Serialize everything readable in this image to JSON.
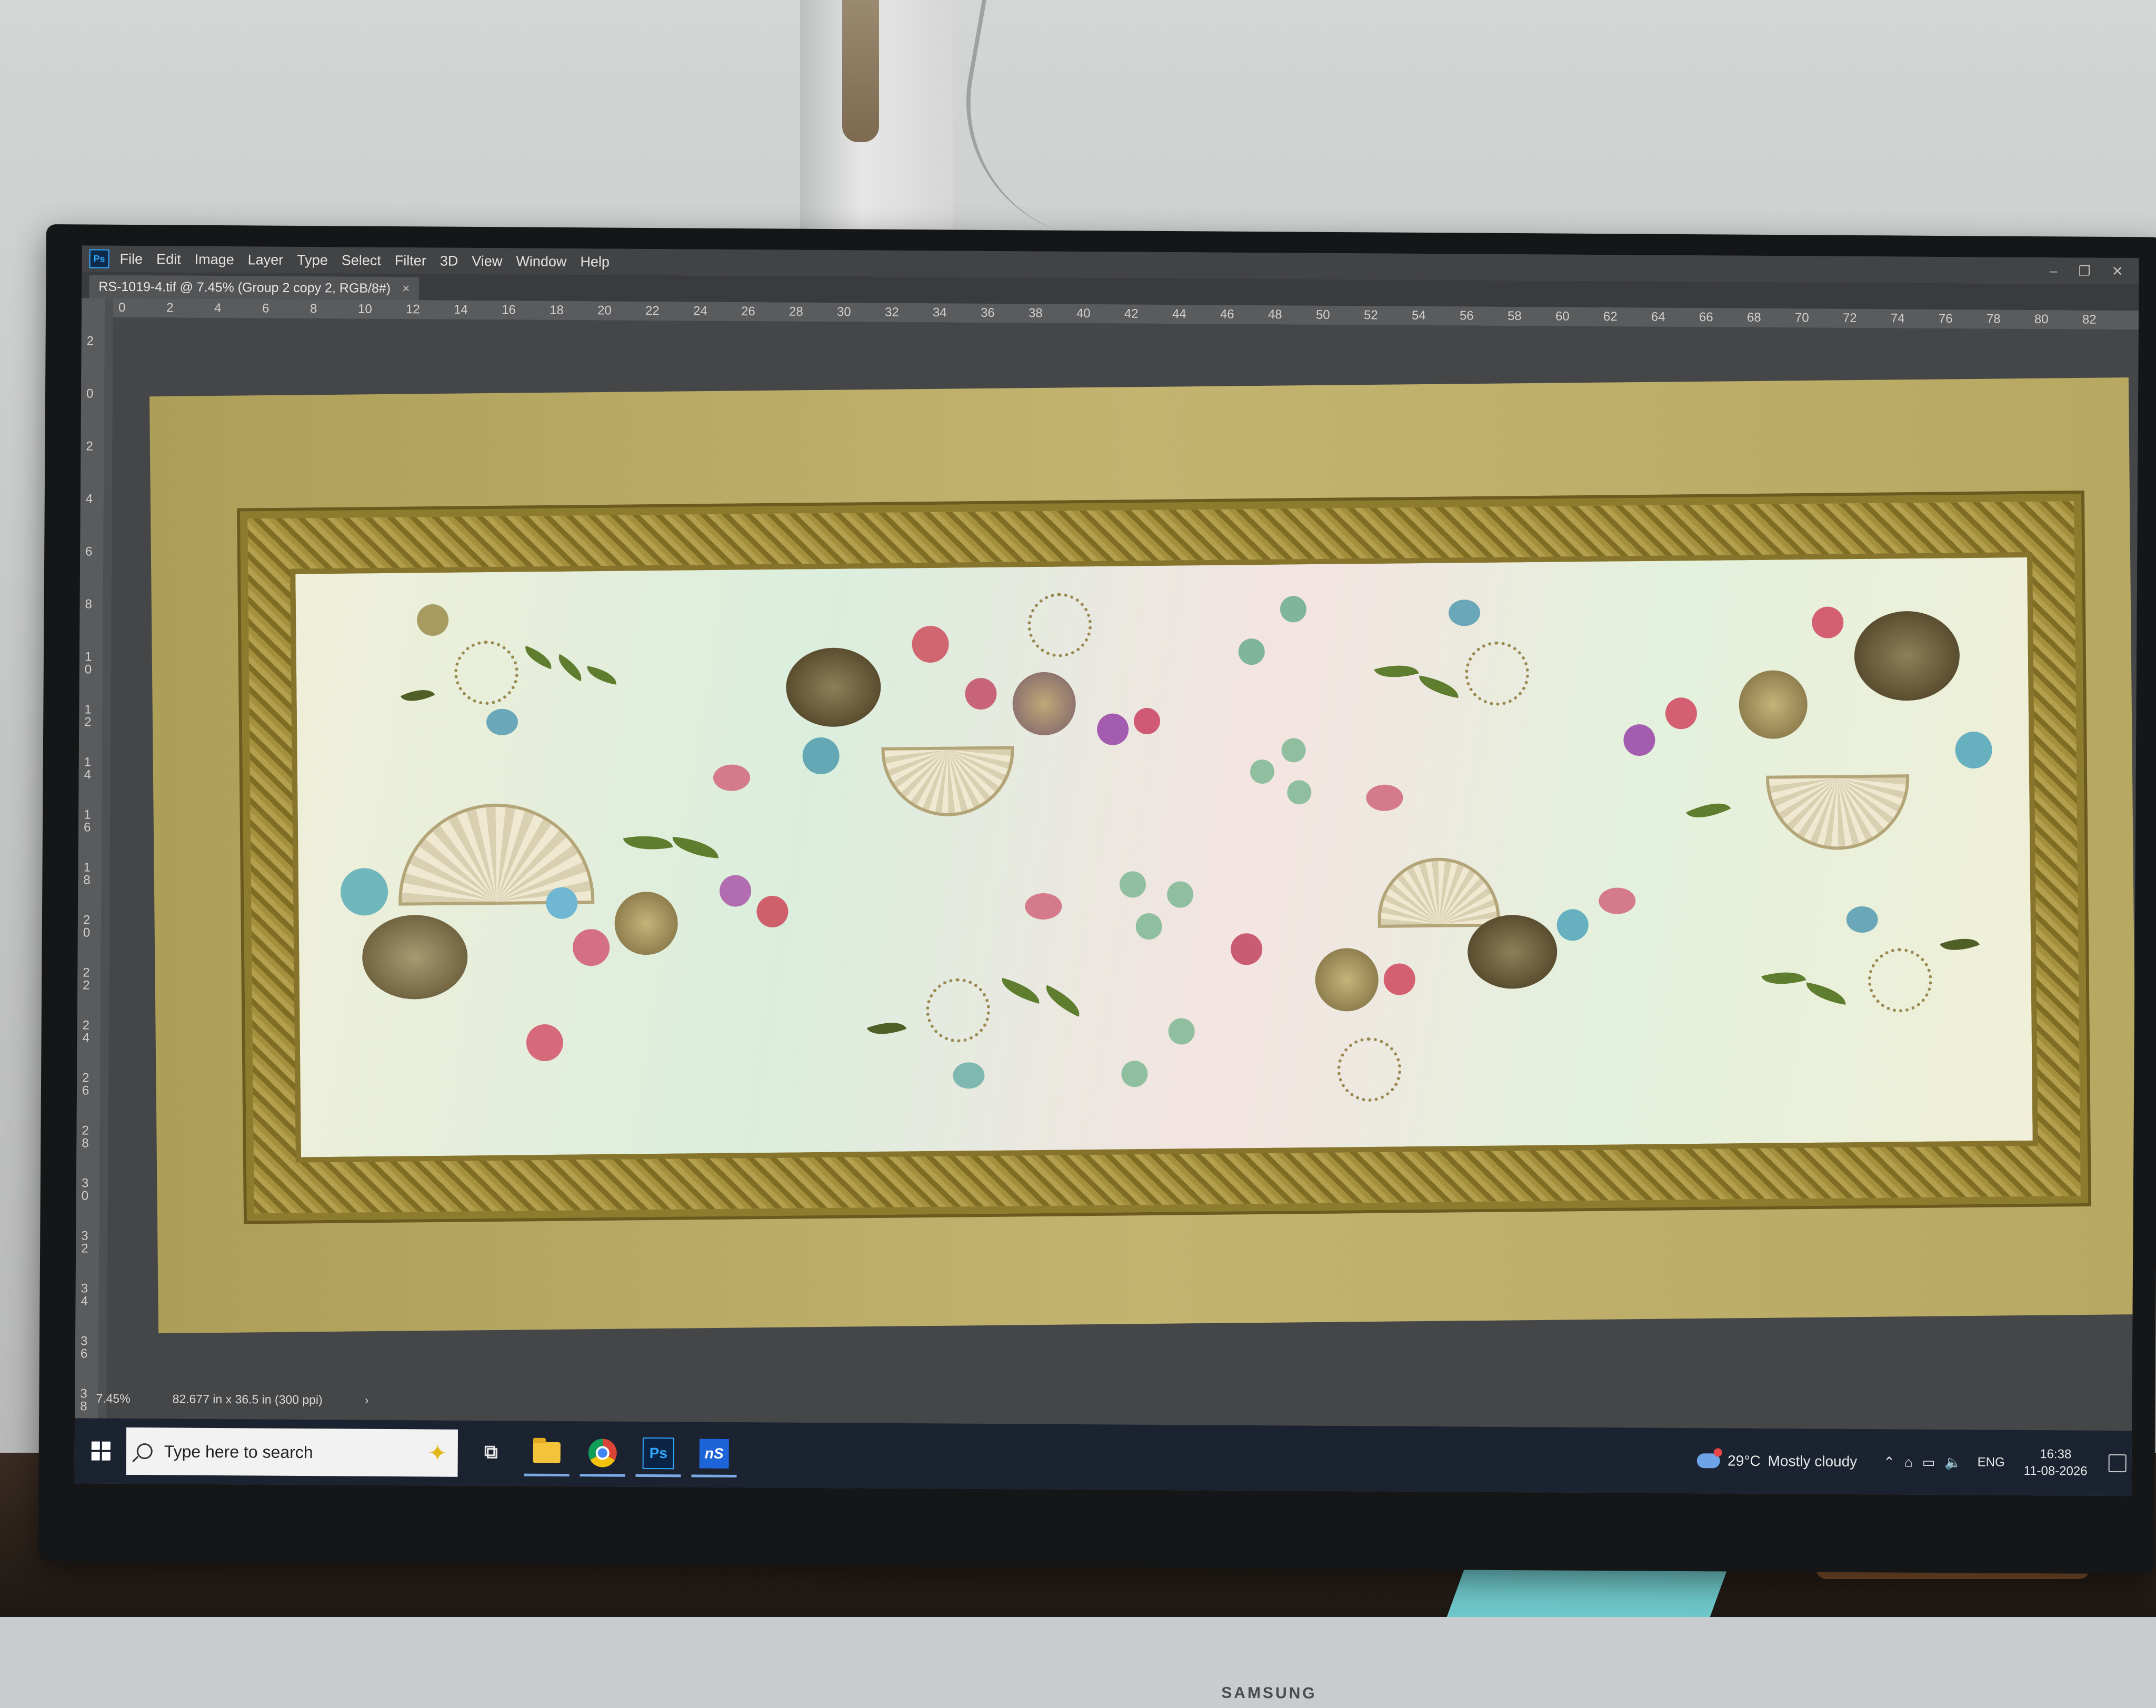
{
  "menubar": {
    "app_icon": "Ps",
    "items": [
      "File",
      "Edit",
      "Image",
      "Layer",
      "Type",
      "Select",
      "Filter",
      "3D",
      "View",
      "Window",
      "Help"
    ]
  },
  "document": {
    "tab_title": "RS-1019-4.tif @ 7.45% (Group 2 copy 2, RGB/8#)",
    "close_glyph": "×"
  },
  "ruler_top": [
    "0",
    "2",
    "4",
    "6",
    "8",
    "10",
    "12",
    "14",
    "16",
    "18",
    "20",
    "22",
    "24",
    "26",
    "28",
    "30",
    "32",
    "34",
    "36",
    "38",
    "40",
    "42",
    "44",
    "46",
    "48",
    "50",
    "52",
    "54",
    "56",
    "58",
    "60",
    "62",
    "64",
    "66",
    "68",
    "70",
    "72",
    "74",
    "76",
    "78",
    "80",
    "82"
  ],
  "ruler_left": [
    "2",
    "0",
    "2",
    "4",
    "6",
    "8",
    "10",
    "12",
    "14",
    "16",
    "18",
    "20",
    "22",
    "24",
    "26",
    "28",
    "30",
    "32",
    "34",
    "36",
    "38"
  ],
  "status": {
    "zoom": "7.45%",
    "doc_info": "82.677 in x 36.5 in (300 ppi)",
    "arrow": "›"
  },
  "taskbar": {
    "search_placeholder": "Type here to search",
    "apps": [
      "task-view",
      "file-explorer",
      "chrome",
      "photoshop",
      "ns-app"
    ],
    "ps_label": "Ps",
    "ns_label": "nS"
  },
  "tray": {
    "temperature": "29°C",
    "weather": "Mostly cloudy",
    "language": "ENG",
    "time": "16:38",
    "date": "11-08-2026"
  },
  "monitor": {
    "brand": "SAMSUNG"
  }
}
